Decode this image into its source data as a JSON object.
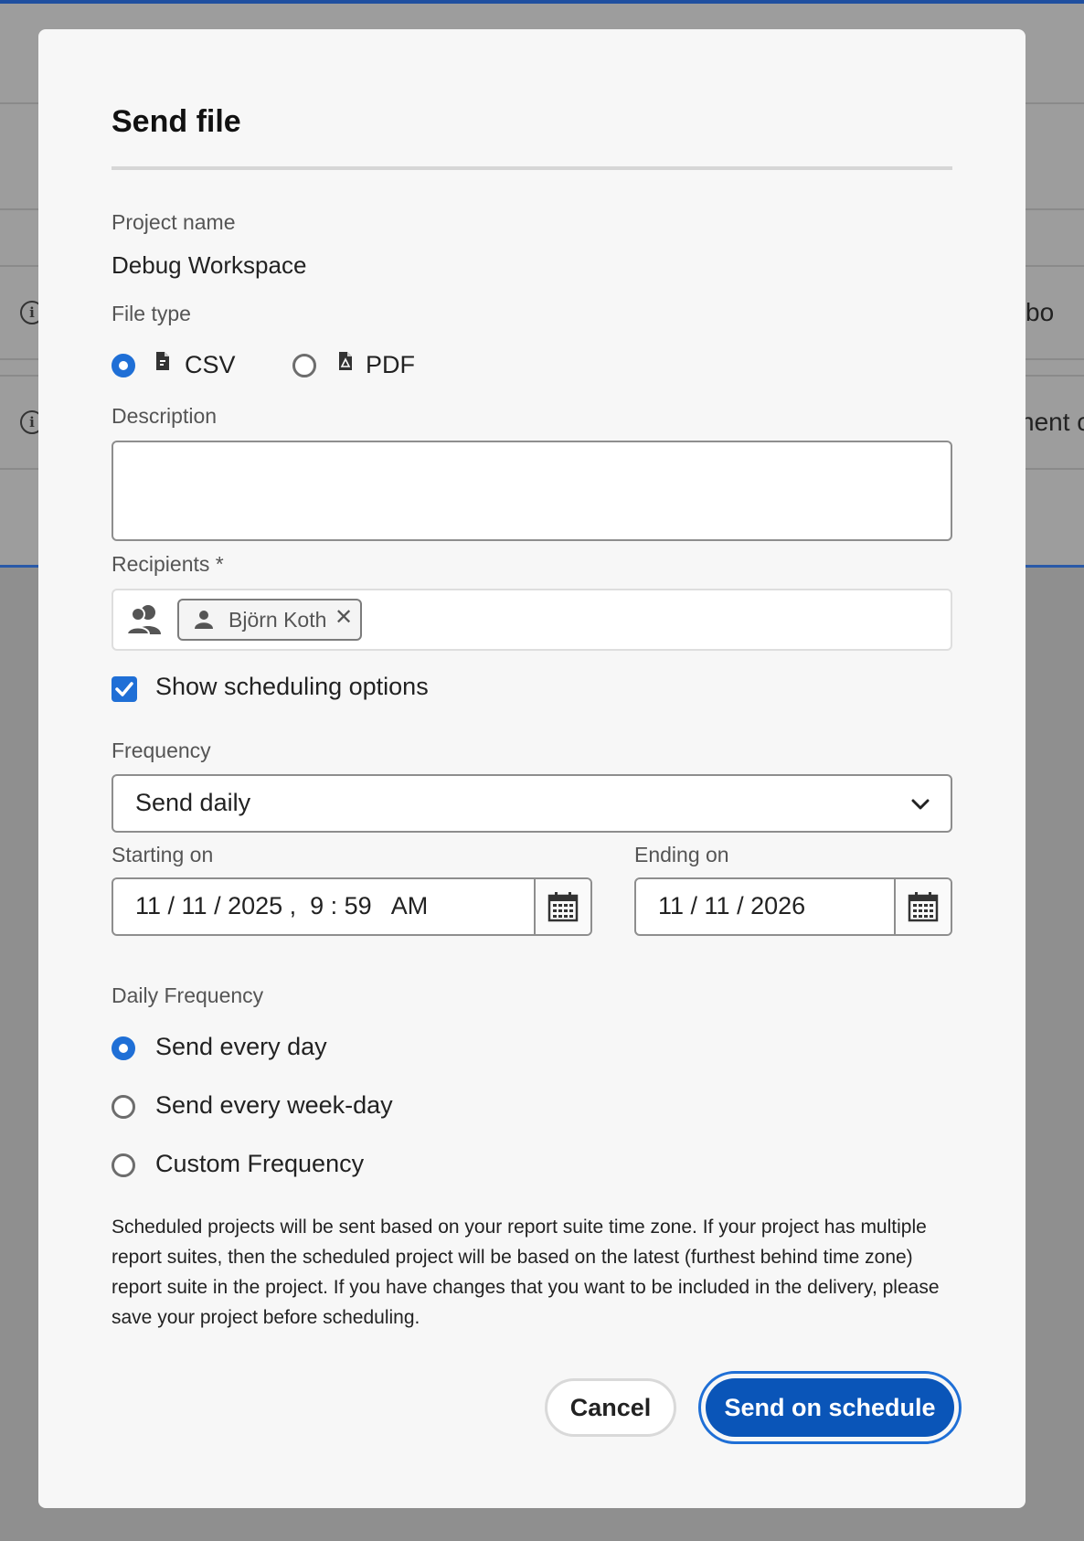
{
  "background": {
    "right_text_row1": "bo",
    "right_text_row2": "nent c"
  },
  "dialog": {
    "title": "Send file",
    "project_name_label": "Project name",
    "project_name_value": "Debug Workspace",
    "file_type_label": "File type",
    "file_types": [
      {
        "label": "CSV",
        "selected": true,
        "icon": "csv-file-icon"
      },
      {
        "label": "PDF",
        "selected": false,
        "icon": "pdf-file-icon"
      }
    ],
    "description_label": "Description",
    "description_value": "",
    "recipients_label": "Recipients",
    "recipients_required_mark": "*",
    "recipients": [
      {
        "name": "Björn Koth",
        "icon": "user-icon"
      }
    ],
    "show_scheduling_label": "Show scheduling options",
    "show_scheduling_checked": true,
    "frequency_label": "Frequency",
    "frequency_value": "Send daily",
    "starting_on_label": "Starting on",
    "starting_on_value": "11 / 11 / 2025 ,  9 : 59   AM",
    "ending_on_label": "Ending on",
    "ending_on_value": "11 / 11 / 2026",
    "daily_frequency_label": "Daily Frequency",
    "daily_options": [
      {
        "label": "Send every day",
        "selected": true
      },
      {
        "label": "Send every week-day",
        "selected": false
      },
      {
        "label": "Custom Frequency",
        "selected": false
      }
    ],
    "note": "Scheduled projects will be sent based on your report suite time zone. If your project has multiple report suites, then the scheduled project will be based on the latest (furthest behind time zone) report suite in the project. If you have changes that you want to be included in the delivery, please save your project before scheduling.",
    "cancel_label": "Cancel",
    "submit_label": "Send on schedule"
  },
  "colors": {
    "accent": "#1f6fd6",
    "primary_button": "#0a55b8",
    "overlay": "#8f8f8f"
  }
}
